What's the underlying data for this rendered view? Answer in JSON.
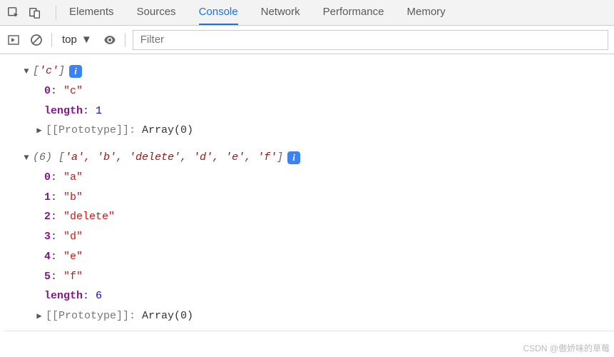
{
  "tabs": {
    "elements": "Elements",
    "sources": "Sources",
    "console": "Console",
    "network": "Network",
    "performance": "Performance",
    "memory": "Memory"
  },
  "subbar": {
    "context": "top",
    "filter_placeholder": "Filter"
  },
  "log1": {
    "summary_open": "[",
    "summary_item": "'c'",
    "summary_close": "]",
    "entries": [
      {
        "key": "0",
        "val": "\"c\""
      }
    ],
    "length_key": "length",
    "length_val": "1",
    "proto_key": "[[Prototype]]",
    "proto_val": "Array(0)"
  },
  "log2": {
    "count": "(6) ",
    "summary_open": "[",
    "summary_items": "'a', 'b', 'delete', 'd', 'e', 'f'",
    "summary_close": "]",
    "entries": [
      {
        "key": "0",
        "val": "\"a\""
      },
      {
        "key": "1",
        "val": "\"b\""
      },
      {
        "key": "2",
        "val": "\"delete\""
      },
      {
        "key": "3",
        "val": "\"d\""
      },
      {
        "key": "4",
        "val": "\"e\""
      },
      {
        "key": "5",
        "val": "\"f\""
      }
    ],
    "length_key": "length",
    "length_val": "6",
    "proto_key": "[[Prototype]]",
    "proto_val": "Array(0)"
  },
  "watermark": "CSDN @傲娇味的草莓"
}
